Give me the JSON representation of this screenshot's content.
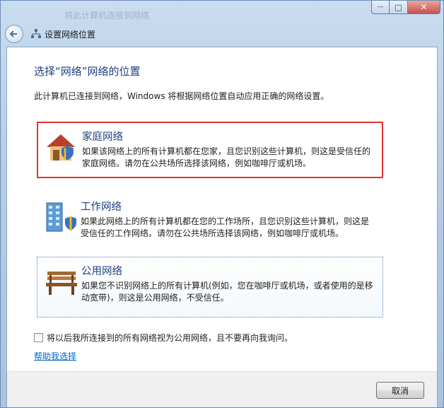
{
  "window": {
    "frame_text": "将此计算机连接到网络",
    "controls": {
      "minimize": "—",
      "maximize": "□",
      "close": "✕"
    }
  },
  "nav": {
    "back_icon": "back-arrow-icon",
    "title": "设置网络位置"
  },
  "main": {
    "heading": "选择“网络”网络的位置",
    "description": "此计算机已连接到网络，Windows 将根据网络位置自动应用正确的网络设置。",
    "options": [
      {
        "title": "家庭网络",
        "description": "如果该网络上的所有计算机都在您家，且您识别这些计算机，则这是受信任的家庭网络。请勿在公共场所选择该网络，例如咖啡厅或机场。",
        "icon": "home-network-icon",
        "highlight_color": "#e2322a"
      },
      {
        "title": "工作网络",
        "description": "如果此网络上的所有计算机都在您的工作场所，且您识别这些计算机，则这是受信任的工作网络。请勿在公共场所选择该网络，例如咖啡厅或机场。",
        "icon": "work-network-icon"
      },
      {
        "title": "公用网络",
        "description": "如果您不识别网络上的所有计算机(例如，您在咖啡厅或机场，或者使用的是移动宽带)，则这是公用网络，不受信任。",
        "icon": "public-network-icon"
      }
    ],
    "checkbox_label": "将以后我所连接到的所有网络视为公用网络，且不要再向我询问。",
    "checkbox_checked": false,
    "help_link": "帮助我选择"
  },
  "footer": {
    "cancel_label": "取消"
  },
  "colors": {
    "heading": "#1f3f83",
    "link": "#0066cc",
    "selection_border": "#e2322a"
  }
}
